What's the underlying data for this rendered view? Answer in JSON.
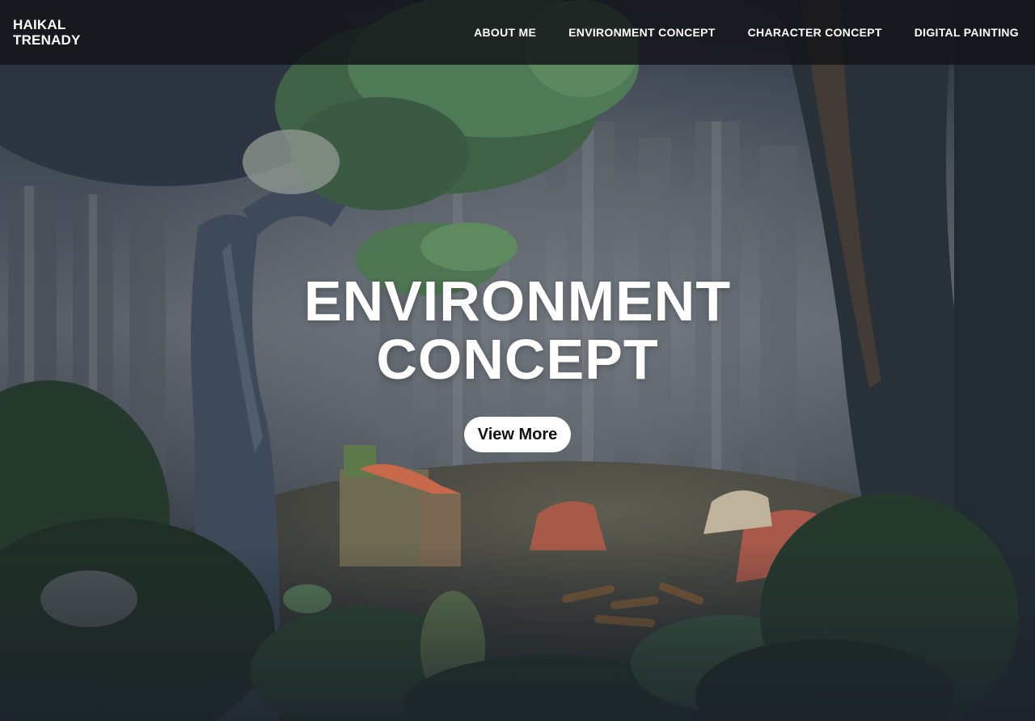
{
  "brand": {
    "line1": "HAIKAL",
    "line2": "TRENADY"
  },
  "nav": {
    "items": [
      {
        "label": "ABOUT ME"
      },
      {
        "label": "ENVIRONMENT CONCEPT"
      },
      {
        "label": "CHARACTER CONCEPT"
      },
      {
        "label": "DIGITAL PAINTING"
      }
    ]
  },
  "hero": {
    "title_line1": "ENVIRONMENT",
    "title_line2": "CONCEPT",
    "button_label": "View More"
  },
  "colors": {
    "navbar_bg": "#121418",
    "text": "#ffffff",
    "button_bg": "#ffffff",
    "button_text": "#111111",
    "forest_dark": "#232c36"
  }
}
